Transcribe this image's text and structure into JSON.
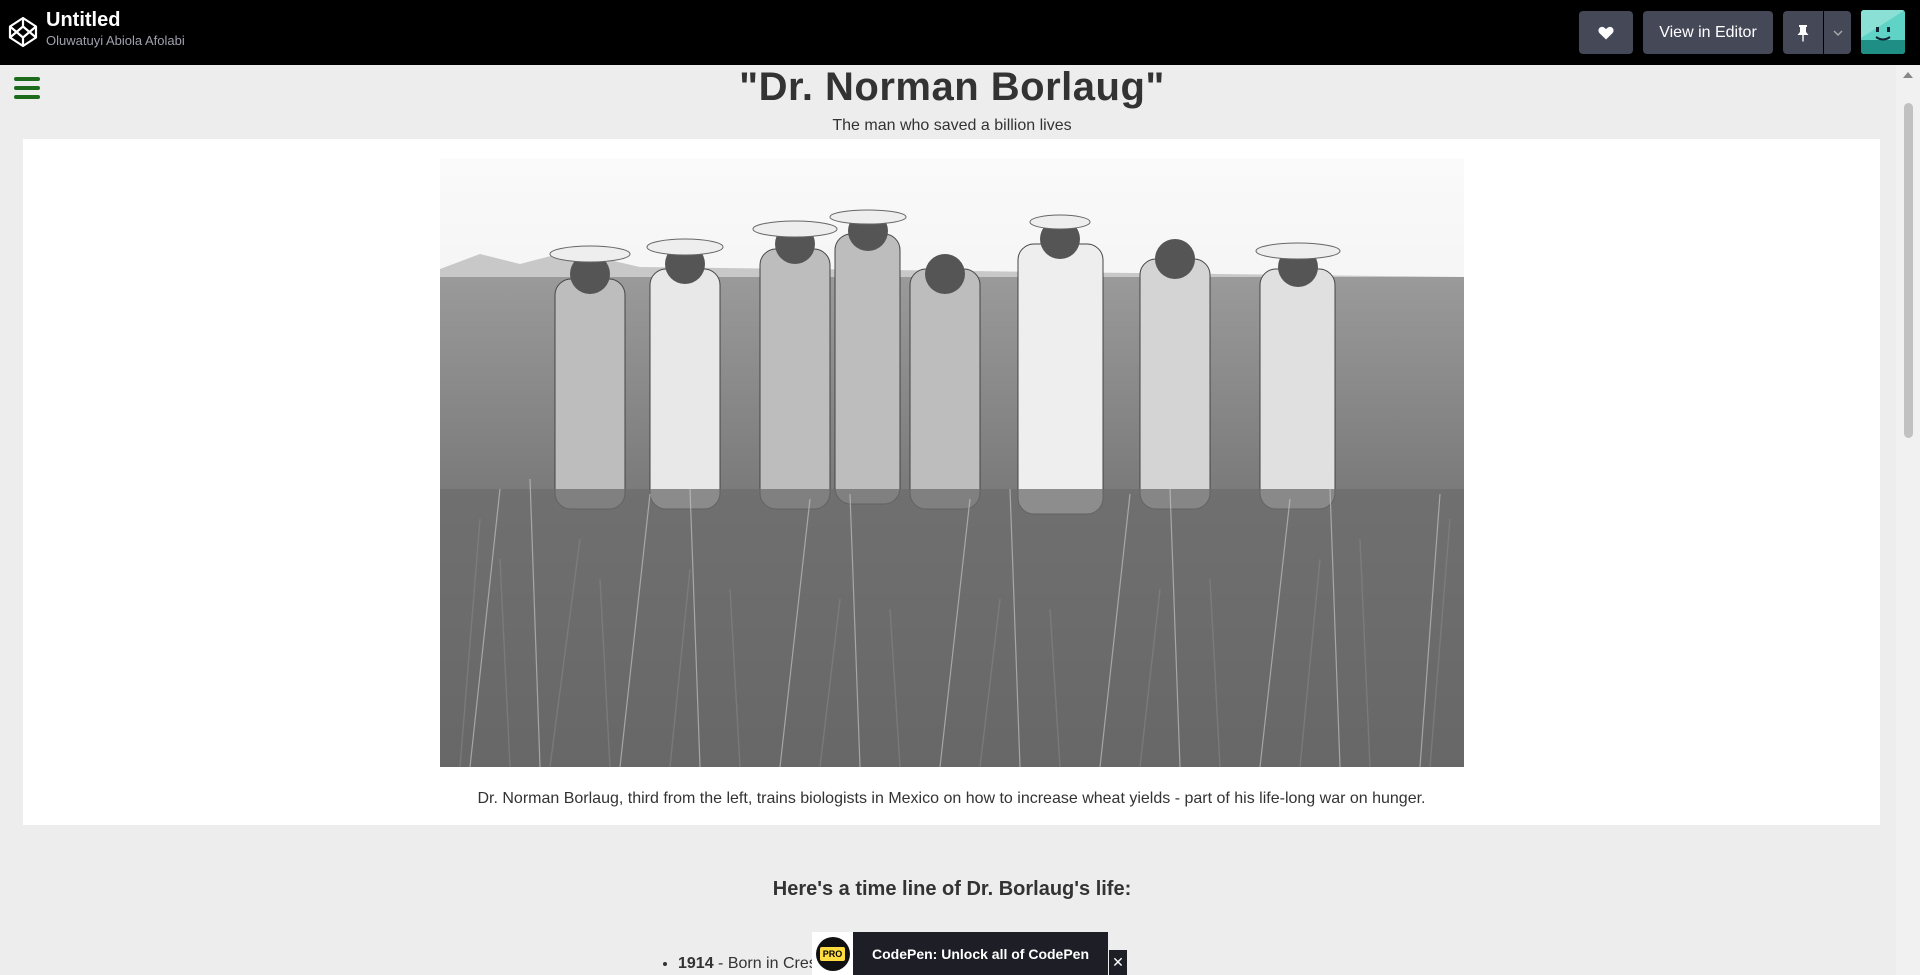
{
  "header": {
    "pen_title": "Untitled",
    "author": "Oluwatuyi Abiola Afolabi",
    "view_in_editor": "View in Editor",
    "icons": [
      "codepen-logo-icon",
      "heart-icon",
      "pin-icon",
      "chevron-down-icon"
    ]
  },
  "page": {
    "title": "\"Dr. Norman Borlaug\"",
    "subtitle": "The man who saved a billion lives",
    "image_caption": "Dr. Norman Borlaug, third from the left, trains biologists in Mexico on how to increase wheat yields - part of his life-long war on hunger.",
    "timeline_heading": "Here's a time line of Dr. Borlaug's life:",
    "timeline": [
      {
        "year": "1914",
        "text": " - Born in Cres"
      }
    ]
  },
  "promo": {
    "badge": "PRO",
    "text": "CodePen: Unlock all of CodePen",
    "close": "✕"
  },
  "colors": {
    "header_bg": "#000000",
    "button_bg": "#444857",
    "page_bg": "#ededed",
    "hamburger": "#1d6b1d",
    "pro_badge": "#ffdd40"
  }
}
